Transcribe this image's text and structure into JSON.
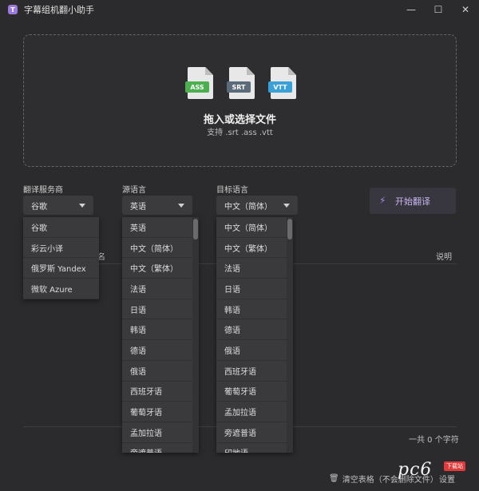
{
  "window": {
    "icon_glyph": "T",
    "title": "字幕组机翻小助手",
    "controls": {
      "minimize": "—",
      "maximize": "☐",
      "close": "✕"
    }
  },
  "dropzone": {
    "file_types": [
      "ASS",
      "SRT",
      "VTT"
    ],
    "file_colors": [
      "#4caf50",
      "#5b6b7a",
      "#3aa0d8"
    ],
    "title": "拖入或选择文件",
    "subtitle": "支持 .srt .ass .vtt"
  },
  "controls": {
    "provider_label": "翻译服务商",
    "provider_value": "谷歌",
    "source_label": "源语言",
    "source_value": "英语",
    "target_label": "目标语言",
    "target_value": "中文（简体）",
    "start_label": "开始翻译",
    "start_icon": "bolt-icon"
  },
  "table": {
    "col_name_partial": "名",
    "col_desc": "说明"
  },
  "provider_options": [
    "谷歌",
    "彩云小译",
    "俄罗斯 Yandex",
    "微软 Azure"
  ],
  "source_options": [
    "英语",
    "中文（简体）",
    "中文（繁体）",
    "法语",
    "日语",
    "韩语",
    "德语",
    "俄语",
    "西班牙语",
    "葡萄牙语",
    "孟加拉语",
    "旁遮普语"
  ],
  "target_options": [
    "中文（简体）",
    "中文（繁体）",
    "法语",
    "日语",
    "韩语",
    "德语",
    "俄语",
    "西班牙语",
    "葡萄牙语",
    "孟加拉语",
    "旁遮普语",
    "印地语"
  ],
  "footer": {
    "count": "一共 0 个字符",
    "clear": "清空表格（不会删除文件）",
    "settings": "设置"
  },
  "watermark": {
    "text": "pc6",
    "badge": "下载站"
  }
}
